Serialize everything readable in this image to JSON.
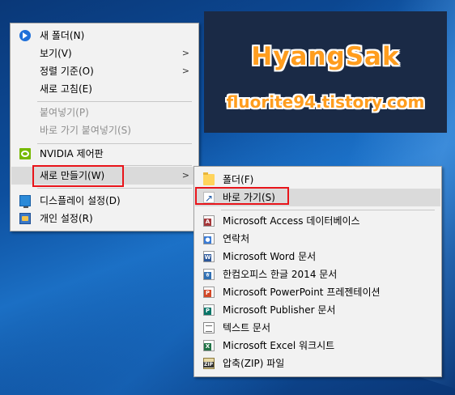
{
  "banner": {
    "title": "HyangSak",
    "subtitle": "fluorite94.tistory.com"
  },
  "context_menu": {
    "items": [
      {
        "label": "새 폴더(N)",
        "icon": "new-folder-icon"
      },
      {
        "label": "보기(V)",
        "submenu": true
      },
      {
        "label": "정렬 기준(O)",
        "submenu": true
      },
      {
        "label": "새로 고침(E)"
      },
      {
        "label": "붙여넣기(P)",
        "disabled": true
      },
      {
        "label": "바로 가기 붙여넣기(S)",
        "disabled": true
      },
      {
        "label": "NVIDIA 제어판",
        "icon": "nvidia-icon"
      },
      {
        "label": "새로 만들기(W)",
        "submenu": true,
        "highlighted": true
      },
      {
        "label": "디스플레이 설정(D)",
        "icon": "display-settings-icon"
      },
      {
        "label": "개인 설정(R)",
        "icon": "personalize-icon"
      }
    ],
    "arrow": ">"
  },
  "new_submenu": {
    "items": [
      {
        "label": "폴더(F)",
        "icon": "folder-icon"
      },
      {
        "label": "바로 가기(S)",
        "icon": "shortcut-icon",
        "highlighted": true
      },
      {
        "label": "Microsoft Access 데이터베이스",
        "icon": "access-icon"
      },
      {
        "label": "연락처",
        "icon": "contact-icon"
      },
      {
        "label": "Microsoft Word 문서",
        "icon": "word-icon"
      },
      {
        "label": "한컴오피스 한글 2014 문서",
        "icon": "hwp-icon"
      },
      {
        "label": "Microsoft PowerPoint 프레젠테이션",
        "icon": "powerpoint-icon"
      },
      {
        "label": "Microsoft Publisher 문서",
        "icon": "publisher-icon"
      },
      {
        "label": "텍스트 문서",
        "icon": "text-document-icon"
      },
      {
        "label": "Microsoft Excel 워크시트",
        "icon": "excel-icon"
      },
      {
        "label": "압축(ZIP) 파일",
        "icon": "zip-icon"
      }
    ]
  },
  "colors": {
    "highlight_box": "#e8141a",
    "banner_text": "#ff9d1e",
    "banner_bg": "#1a2a46"
  }
}
